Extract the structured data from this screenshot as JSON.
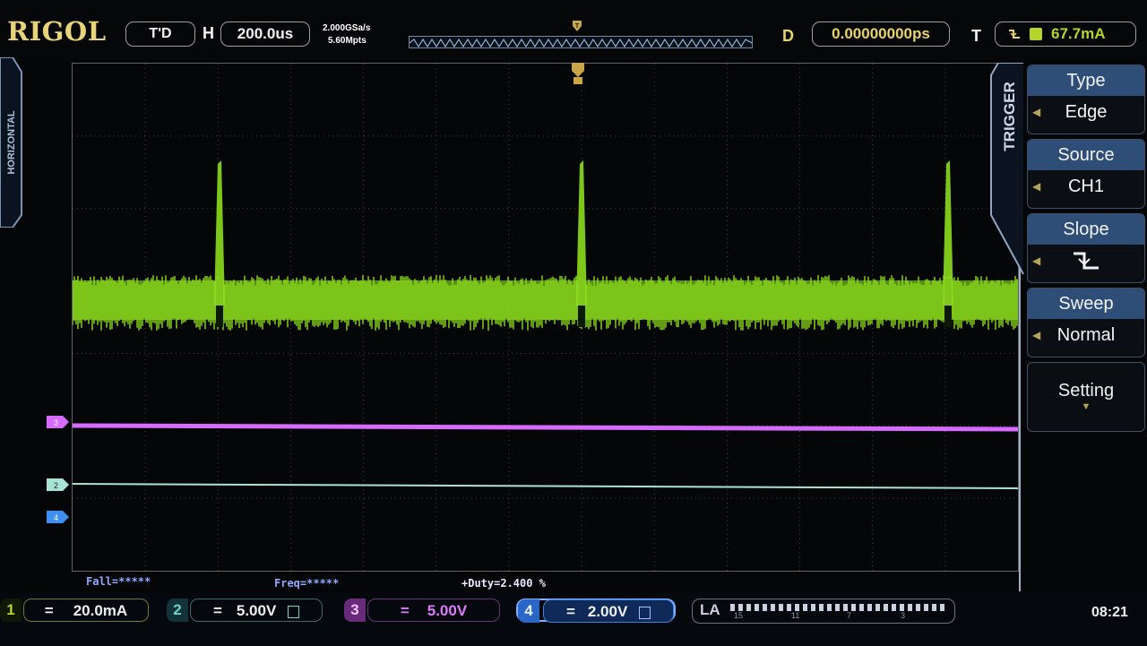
{
  "brand": "RIGOL",
  "status": {
    "run_state": "T'D",
    "horizontal_label": "H",
    "timebase": "200.0us"
  },
  "sample": {
    "rate": "2.000GSa/s",
    "memory": "5.60Mpts"
  },
  "delay": {
    "label": "D",
    "value": "0.00000000ps"
  },
  "trigger_status": {
    "label": "T",
    "level": "67.7mA"
  },
  "side_tabs": {
    "horizontal": "HORIZONTAL",
    "trigger": "TRIGGER"
  },
  "menu": {
    "type_label": "Type",
    "type_value": "Edge",
    "source_label": "Source",
    "source_value": "CH1",
    "slope_label": "Slope",
    "sweep_label": "Sweep",
    "sweep_value": "Normal",
    "setting_label": "Setting"
  },
  "measurements": {
    "fall": "Fall=*****",
    "freq": "Freq=*****",
    "duty": "+Duty=2.400 %"
  },
  "channels": [
    {
      "num": "1",
      "coupling": "=",
      "scale": "20.0mA",
      "color": "#b8d32a"
    },
    {
      "num": "2",
      "coupling": "=",
      "scale": "5.00V",
      "color": "#6fd3c8"
    },
    {
      "num": "3",
      "coupling": "=",
      "scale": "5.00V",
      "color": "#d65cf0"
    },
    {
      "num": "4",
      "coupling": "=",
      "scale": "2.00V",
      "color": "#3f8ff0"
    }
  ],
  "la": {
    "label": "LA",
    "ticks": [
      "15",
      "11",
      "7",
      "3"
    ]
  },
  "clock": "08:21",
  "colors": {
    "ch1_trace": "#8ddb1e",
    "ch2_trace": "#a9e3d6",
    "ch3_trace": "#d86bff",
    "ch4_marker": "#3f8ff0",
    "menu_head": "#2e4e78"
  }
}
